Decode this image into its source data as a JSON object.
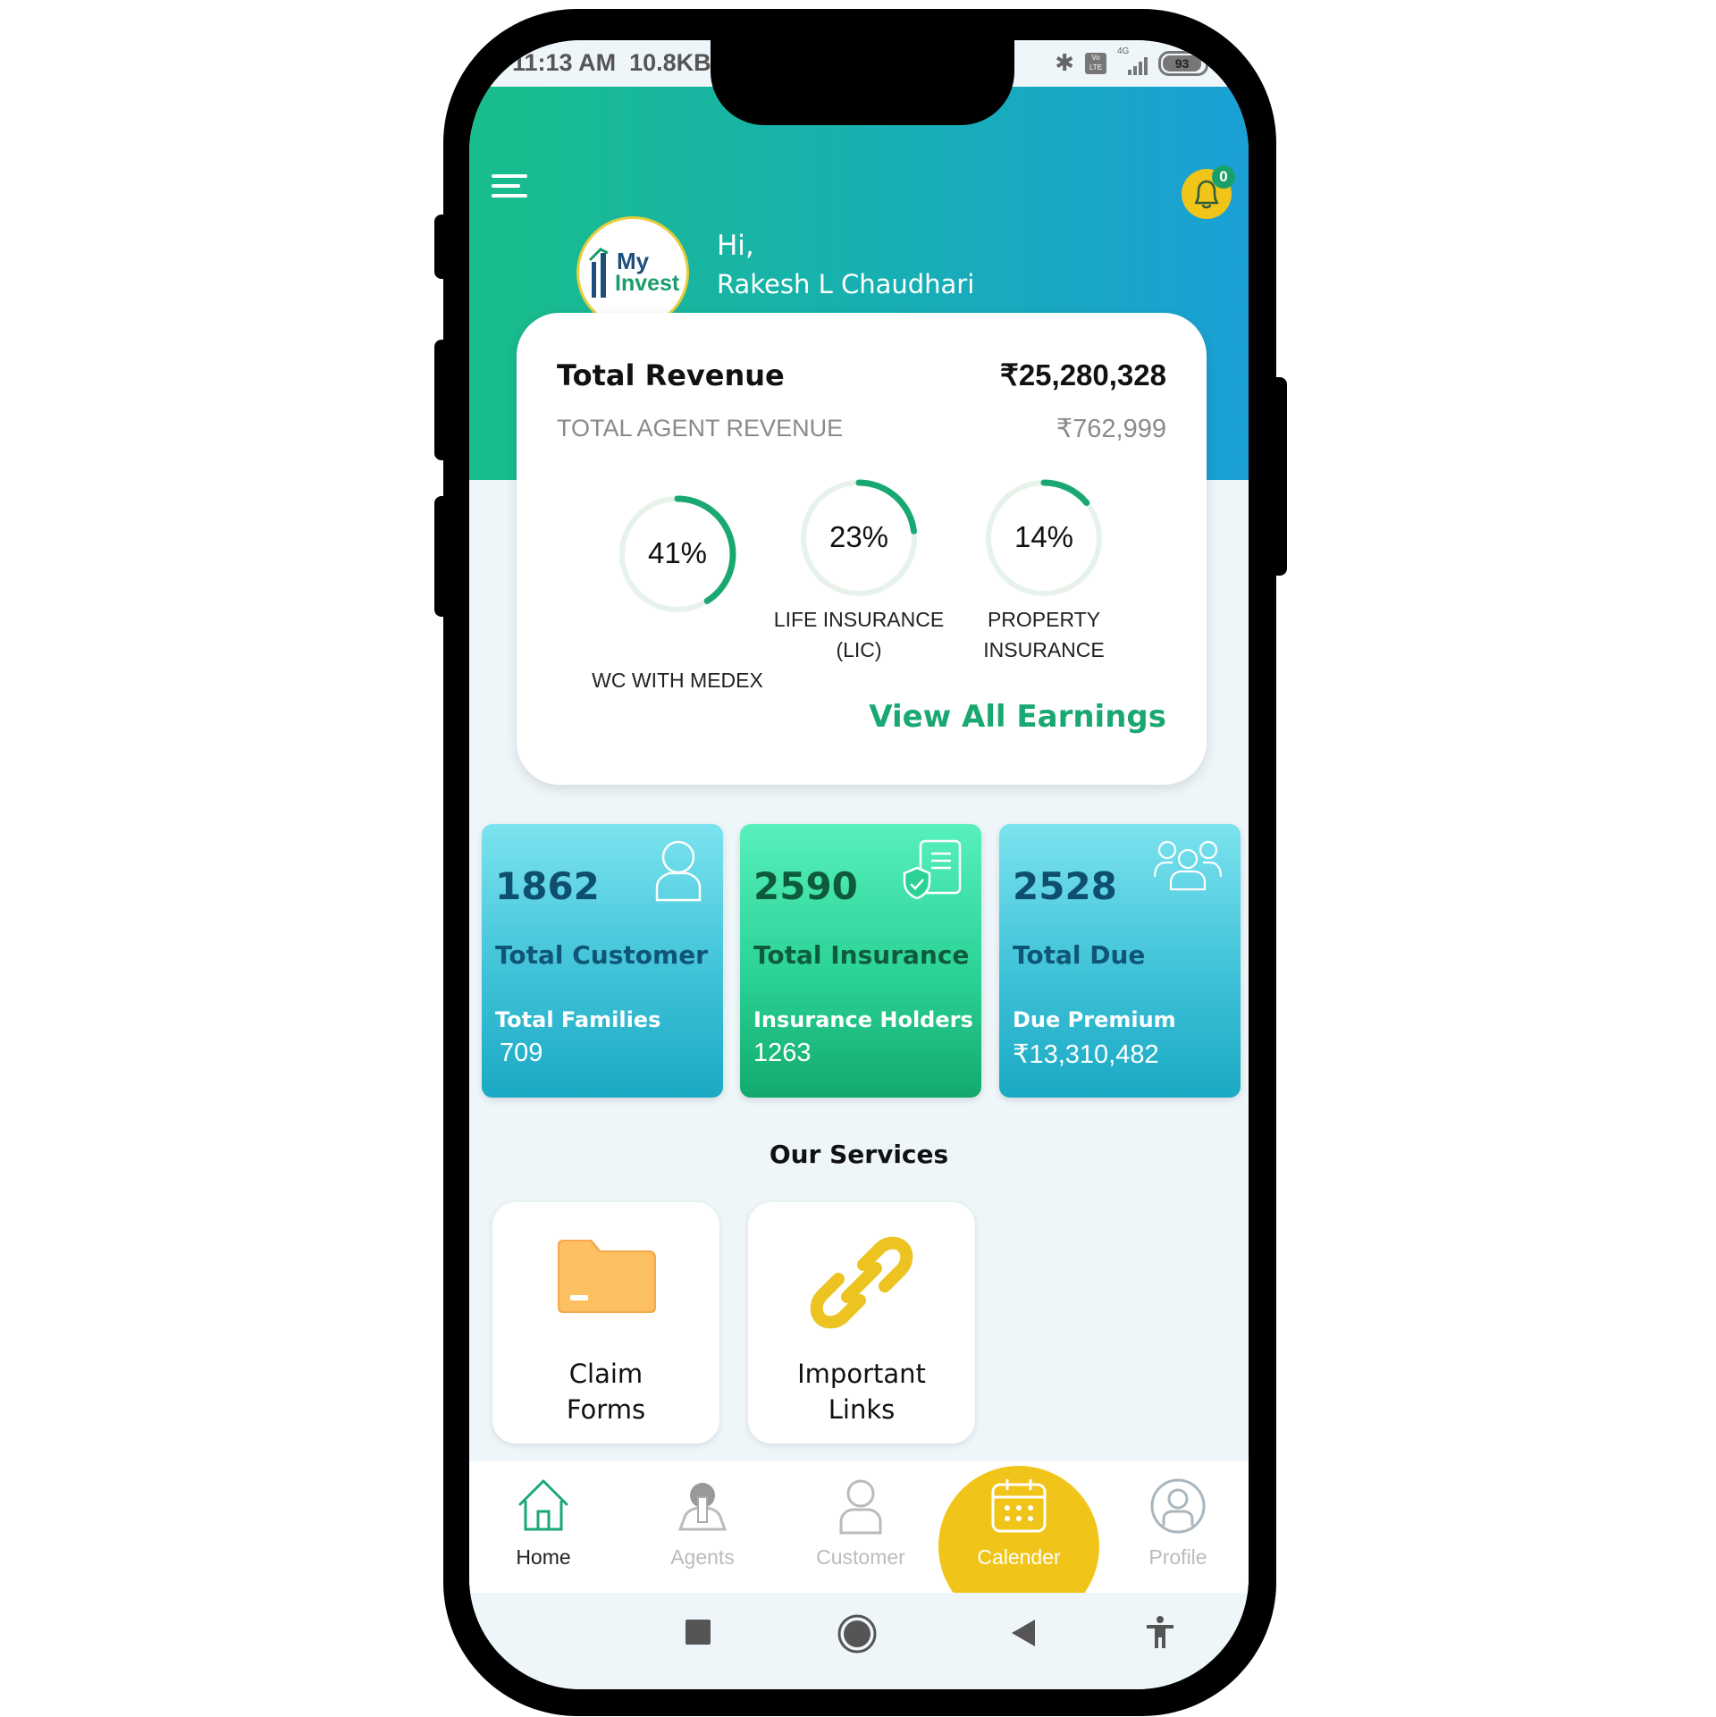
{
  "status_bar": {
    "time": "11:13 AM",
    "network_speed": "10.8KB",
    "network_type": "4G",
    "volte": "Vo LTE",
    "battery": "93"
  },
  "header": {
    "notification_count": "0",
    "logo_line1": "My",
    "logo_line2": "Invest",
    "greeting": "Hi,",
    "user_name": "Rakesh L Chaudhari",
    "gradient_colors": [
      "#19bd8a",
      "#1aa0d6"
    ]
  },
  "revenue": {
    "title": "Total Revenue",
    "value": "₹25,280,328",
    "agent_title": "TOTAL AGENT REVENUE",
    "agent_value": "₹762,999",
    "breakdown": [
      {
        "percent": 41,
        "label_line1": "",
        "label_line2": "WC WITH MEDEX",
        "pct_text": "41%"
      },
      {
        "percent": 23,
        "label_line1": "LIFE INSURANCE",
        "label_line2": "(LIC)",
        "pct_text": "23%"
      },
      {
        "percent": 14,
        "label_line1": "PROPERTY",
        "label_line2": "INSURANCE",
        "pct_text": "14%"
      }
    ],
    "view_all_label": "View All Earnings",
    "accent_color": "#1aa872"
  },
  "stats": [
    {
      "number": "1862",
      "title": "Total Customer",
      "sub_label": "Total Families",
      "sub_value": "709",
      "icon": "user-icon"
    },
    {
      "number": "2590",
      "title": "Total Insurance",
      "sub_label": "Insurance Holders",
      "sub_value": "1263",
      "icon": "insurance-document-icon"
    },
    {
      "number": "2528",
      "title": "Total Due",
      "sub_label": "Due Premium",
      "sub_value": "₹13,310,482",
      "icon": "group-icon"
    }
  ],
  "services": {
    "title": "Our Services",
    "items": [
      {
        "label_line1": "Claim",
        "label_line2": "Forms",
        "icon": "folder-icon"
      },
      {
        "label_line1": "Important",
        "label_line2": "Links",
        "icon": "link-icon"
      }
    ]
  },
  "bottom_nav": {
    "items": [
      {
        "label": "Home",
        "icon": "home-icon",
        "active": true
      },
      {
        "label": "Agents",
        "icon": "agent-icon"
      },
      {
        "label": "Customer",
        "icon": "customer-icon"
      },
      {
        "label": "Calender",
        "icon": "calendar-icon",
        "highlighted": true
      },
      {
        "label": "Profile",
        "icon": "profile-icon"
      }
    ]
  }
}
